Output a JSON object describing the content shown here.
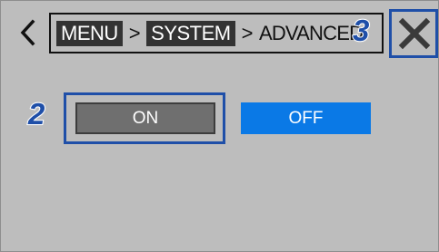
{
  "header": {
    "back_icon": "chevron-left-icon",
    "breadcrumb": {
      "items": [
        "MENU",
        "SYSTEM",
        "ADVANCED"
      ],
      "separator": ">"
    },
    "close_icon": "close-x-icon"
  },
  "callouts": {
    "close": "3",
    "on": "2"
  },
  "toggle": {
    "on_label": "ON",
    "off_label": "OFF"
  },
  "colors": {
    "screen_background": "#bdbdbd",
    "callout_blue": "#1f4fa8",
    "off_button_blue": "#0a79e6",
    "on_button_gray": "#6f6f6f"
  }
}
